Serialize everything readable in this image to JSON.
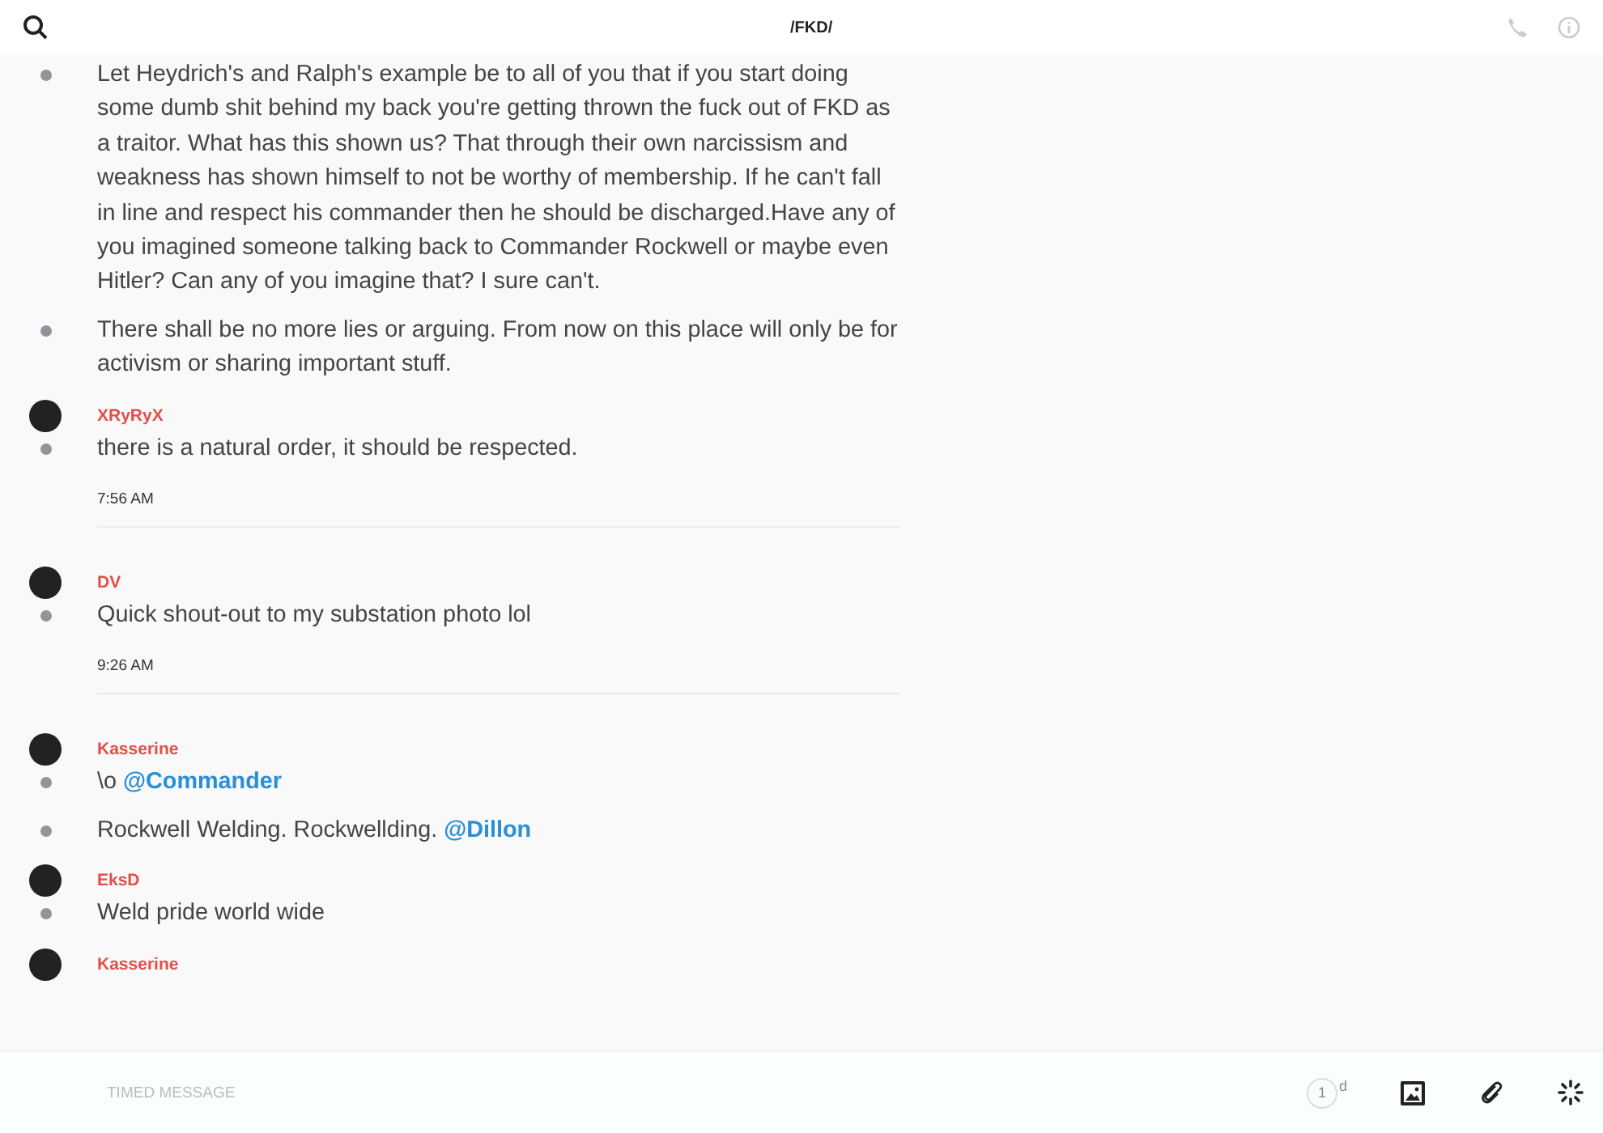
{
  "header": {
    "title": "/FKD/"
  },
  "feed": [
    {
      "kind": "group",
      "messages": [
        {
          "parts": [
            {
              "kind": "text",
              "text": "Let Heydrich's and Ralph's example be to all of you that if you start doing some dumb shit behind my back you're getting thrown the fuck out of FKD as a traitor. What has this shown us? That through their own narcissism and weakness has shown himself to not be worthy of membership. If he can't fall in line and respect his commander then he should be discharged.Have any of you imagined someone talking back to Commander Rockwell or maybe even Hitler? Can any of you imagine that? I sure can't."
            }
          ]
        },
        {
          "parts": [
            {
              "kind": "text",
              "text": "There shall be no more lies or arguing. From now on this place will only be for activism or sharing important stuff."
            }
          ]
        }
      ]
    },
    {
      "kind": "group",
      "author": "XRyRyX",
      "messages": [
        {
          "parts": [
            {
              "kind": "text",
              "text": "there is a natural order, it should be respected."
            }
          ]
        }
      ]
    },
    {
      "kind": "time",
      "text": "7:56 AM"
    },
    {
      "kind": "group",
      "author": "DV",
      "messages": [
        {
          "parts": [
            {
              "kind": "text",
              "text": "Quick shout-out to my substation photo lol"
            }
          ]
        }
      ]
    },
    {
      "kind": "time",
      "text": "9:26 AM"
    },
    {
      "kind": "group",
      "author": "Kasserine",
      "messages": [
        {
          "parts": [
            {
              "kind": "text",
              "text": "\\o "
            },
            {
              "kind": "mention",
              "text": "@Commander"
            }
          ]
        },
        {
          "parts": [
            {
              "kind": "text",
              "text": "Rockwell Welding. Rockwellding. "
            },
            {
              "kind": "mention",
              "text": "@Dillon"
            }
          ]
        }
      ]
    },
    {
      "kind": "group",
      "author": "EksD",
      "messages": [
        {
          "parts": [
            {
              "kind": "text",
              "text": "Weld pride world wide"
            }
          ]
        }
      ]
    },
    {
      "kind": "group",
      "author": "Kasserine"
    }
  ],
  "composer": {
    "placeholder": "TIMED MESSAGE",
    "timer_value": "1",
    "timer_unit": "d"
  }
}
